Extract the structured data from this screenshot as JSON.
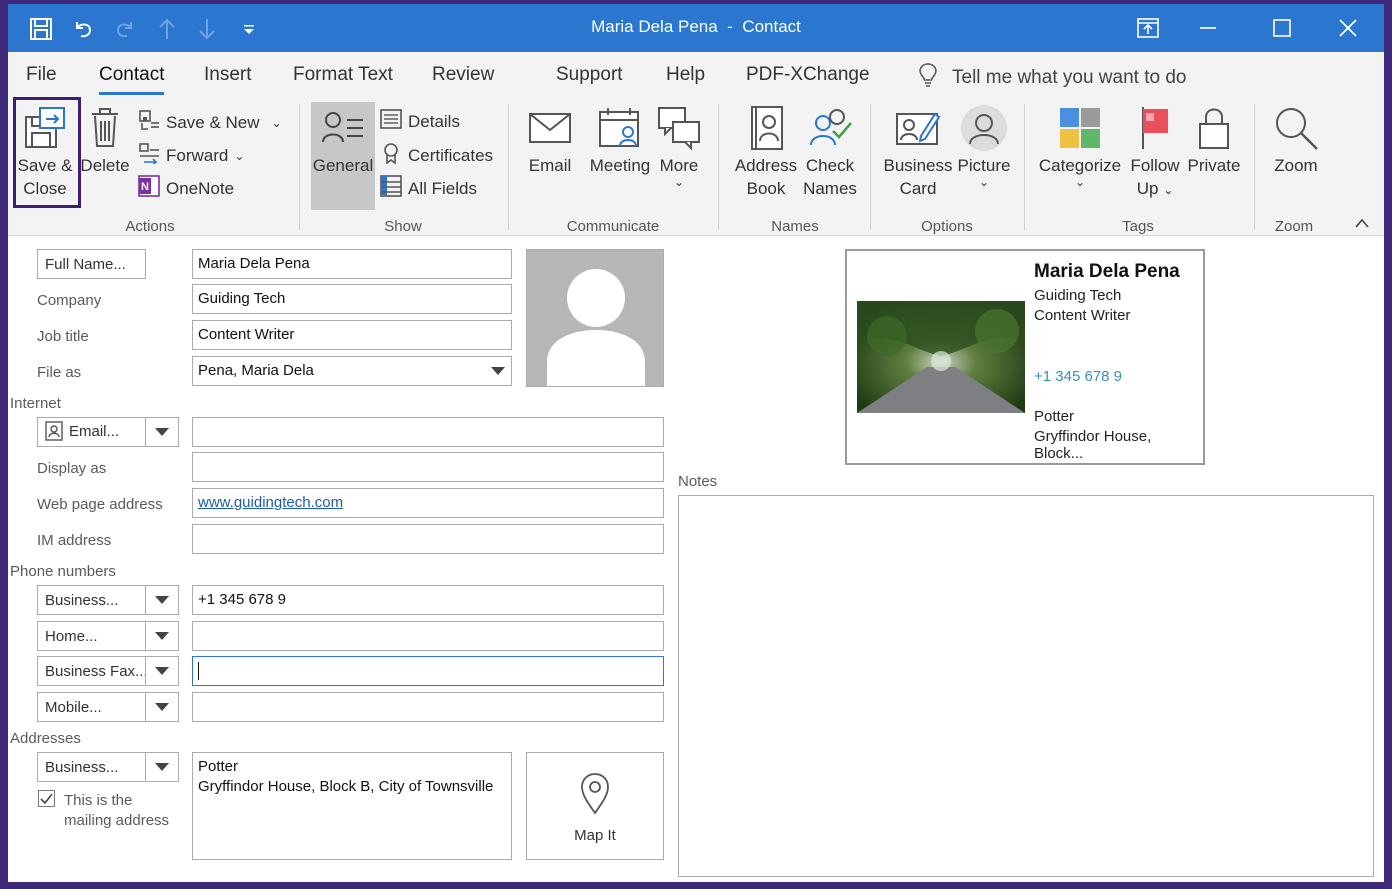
{
  "window": {
    "title": "Maria Dela Pena",
    "sep": "-",
    "kind": "Contact",
    "accent": "#2b76cf",
    "frame": "#3f2a7a"
  },
  "quick_access": [
    "save-icon",
    "undo-icon",
    "redo-icon",
    "up-arrow-icon",
    "down-arrow-icon",
    "customize-icon"
  ],
  "tabs": [
    "File",
    "Contact",
    "Insert",
    "Format Text",
    "Review",
    "Support",
    "Help",
    "PDF-XChange"
  ],
  "tell_me": "Tell me what you want to do",
  "ribbon": {
    "actions": {
      "label": "Actions",
      "save_close": [
        "Save &",
        "Close"
      ],
      "delete": "Delete",
      "save_new": "Save & New",
      "forward": "Forward",
      "onenote": "OneNote"
    },
    "show": {
      "label": "Show",
      "general": "General",
      "details": "Details",
      "certificates": "Certificates",
      "all_fields": "All Fields"
    },
    "communicate": {
      "label": "Communicate",
      "email": "Email",
      "meeting": "Meeting",
      "more": "More"
    },
    "names": {
      "label": "Names",
      "address_book": [
        "Address",
        "Book"
      ],
      "check_names": [
        "Check",
        "Names"
      ]
    },
    "options": {
      "label": "Options",
      "business_card": [
        "Business",
        "Card"
      ],
      "picture": "Picture"
    },
    "tags": {
      "label": "Tags",
      "categorize": "Categorize",
      "follow_up": [
        "Follow",
        "Up"
      ],
      "private": "Private"
    },
    "zoom": {
      "label": "Zoom",
      "zoom": "Zoom"
    }
  },
  "form": {
    "full_name_btn": "Full Name...",
    "full_name": "Maria Dela Pena",
    "company_label": "Company",
    "company": "Guiding Tech",
    "job_title_label": "Job title",
    "job_title": "Content Writer",
    "file_as_label": "File as",
    "file_as": "Pena, Maria Dela",
    "internet_label": "Internet",
    "email_btn": "Email...",
    "email": "",
    "display_as_label": "Display as",
    "display_as": "",
    "web_label": "Web page address",
    "web": "www.guidingtech.com",
    "im_label": "IM address",
    "im": "",
    "phone_label": "Phone numbers",
    "phones": [
      {
        "type": "Business...",
        "value": "+1 345 678 9"
      },
      {
        "type": "Home...",
        "value": ""
      },
      {
        "type": "Business Fax...",
        "value": ""
      },
      {
        "type": "Mobile...",
        "value": ""
      }
    ],
    "addresses_label": "Addresses",
    "address_type": "Business...",
    "address_line1": "Potter",
    "address_line2": "Gryffindor House, Block B, City of Townsville",
    "mailing_line1": "This is the",
    "mailing_line2": "mailing address",
    "mailing_checked": true,
    "map_it": "Map It",
    "notes_label": "Notes"
  },
  "card": {
    "name": "Maria Dela Pena",
    "company": "Guiding Tech",
    "title": "Content Writer",
    "phone": "+1 345 678 9",
    "addr1": "Potter",
    "addr2": "Gryffindor House, Block..."
  }
}
